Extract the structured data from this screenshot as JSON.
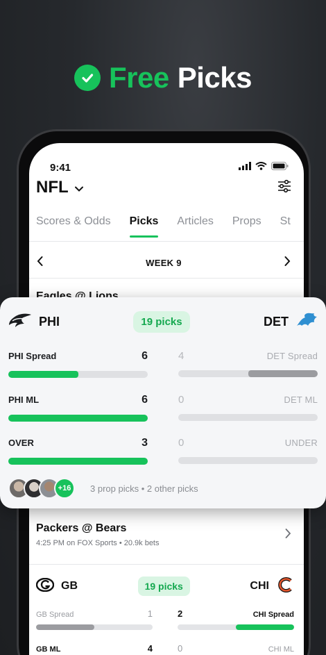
{
  "headline": {
    "word1": "Free",
    "word2": "Picks"
  },
  "status": {
    "time": "9:41"
  },
  "header": {
    "league": "NFL"
  },
  "tabs": [
    {
      "label": "Scores & Odds",
      "active": false
    },
    {
      "label": "Picks",
      "active": true
    },
    {
      "label": "Articles",
      "active": false
    },
    {
      "label": "Props",
      "active": false
    },
    {
      "label": "St",
      "active": false
    }
  ],
  "week": {
    "label": "WEEK 9"
  },
  "game1": {
    "title": "Eagles @ Lions",
    "away": "PHI",
    "home": "DET",
    "picks_label": "19 picks",
    "rows": [
      {
        "left_label": "PHI Spread",
        "left_value": "6",
        "left_fill": 0.5,
        "right_label": "DET Spread",
        "right_value": "4",
        "right_fill": 0.5
      },
      {
        "left_label": "PHI ML",
        "left_value": "6",
        "left_fill": 1.0,
        "right_label": "DET ML",
        "right_value": "0",
        "right_fill": 0
      },
      {
        "left_label": "OVER",
        "left_value": "3",
        "left_fill": 1.0,
        "right_label": "UNDER",
        "right_value": "0",
        "right_fill": 0
      }
    ],
    "extra_count": "+16",
    "footer": "3 prop picks • 2 other picks"
  },
  "game2": {
    "title": "Packers @ Bears",
    "meta": "4:25 PM on FOX Sports • 20.9k bets",
    "away": "GB",
    "home": "CHI",
    "picks_label": "19 picks",
    "rows": [
      {
        "left_label": "GB Spread",
        "left_value": "1",
        "left_fill": 0.5,
        "right_label": "CHI Spread",
        "right_value": "2",
        "right_fill": 0.5
      },
      {
        "left_label": "GB ML",
        "left_value": "4",
        "left_fill": 1.0,
        "right_label": "CHI ML",
        "right_value": "0",
        "right_fill": 0
      }
    ]
  },
  "colors": {
    "accent": "#17c25b",
    "dark_fill": "#9b9ca0",
    "track": "#dfe0e3"
  }
}
